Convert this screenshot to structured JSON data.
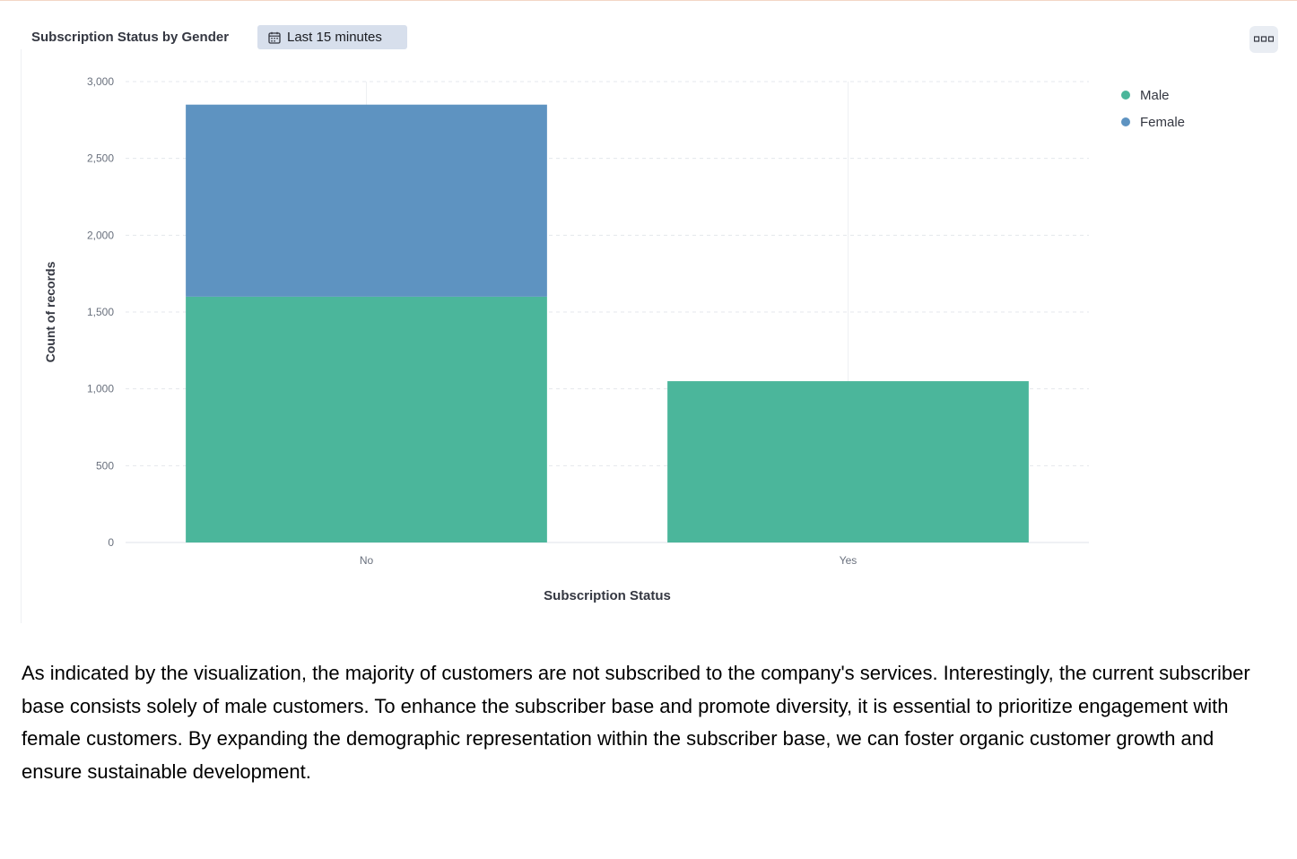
{
  "panel": {
    "title": "Subscription Status by Gender",
    "time_range_label": "Last 15 minutes",
    "time_icon": "calendar-icon",
    "options_icon": "more-options-icon"
  },
  "colors": {
    "male": "#4bb69b",
    "female": "#5e93c1",
    "badge_bg": "#d7dfec",
    "grid": "#e4e7ec"
  },
  "chart_data": {
    "type": "bar",
    "stacked": true,
    "title": "",
    "xlabel": "Subscription Status",
    "ylabel": "Count of records",
    "categories": [
      "No",
      "Yes"
    ],
    "series": [
      {
        "name": "Male",
        "values": [
          1600,
          1050
        ],
        "color": "#4bb69b"
      },
      {
        "name": "Female",
        "values": [
          1250,
          0
        ],
        "color": "#5e93c1"
      }
    ],
    "ylim": [
      0,
      3000
    ],
    "yticks": [
      0,
      500,
      1000,
      1500,
      2000,
      2500,
      3000
    ],
    "ytick_labels": [
      "0",
      "500",
      "1,000",
      "1,500",
      "2,000",
      "2,500",
      "3,000"
    ],
    "grid": true,
    "legend": "top-right"
  },
  "description": "As indicated by the visualization, the majority of customers are not subscribed to the company's services. Interestingly, the current subscriber base consists solely of male customers. To enhance the subscriber base and promote diversity, it is essential to prioritize engagement with female customers. By expanding the demographic representation within the subscriber base, we can foster organic customer growth and ensure sustainable development."
}
